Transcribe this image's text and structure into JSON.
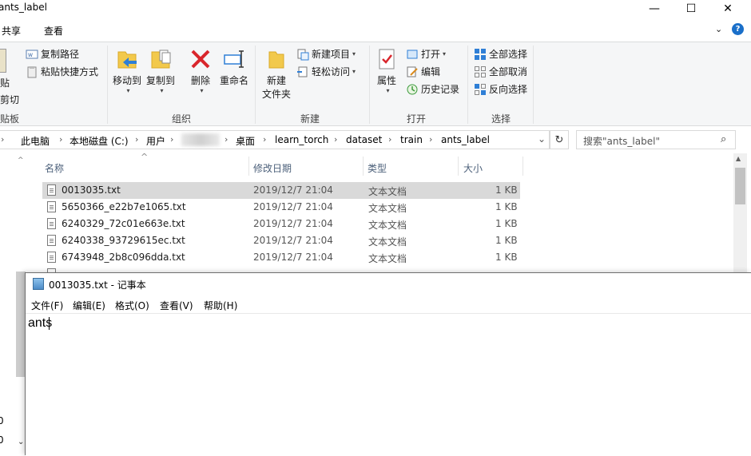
{
  "window": {
    "title": "ants_label",
    "min_glyph": "—",
    "max_glyph": "☐",
    "close_glyph": "✕"
  },
  "ribbon_tabs": [
    {
      "label": "共享"
    },
    {
      "label": "查看"
    }
  ],
  "ribbon": {
    "clipboard": {
      "paste_partial": "贴",
      "cut_partial": "剪切",
      "group_partial": "贴板",
      "copy_path": "复制路径",
      "paste_shortcut": "粘贴快捷方式"
    },
    "organize": {
      "move_to": "移动到",
      "copy_to": "复制到",
      "delete": "删除",
      "rename": "重命名",
      "group": "组织"
    },
    "new": {
      "new_folder_line1": "新建",
      "new_folder_line2": "文件夹",
      "new_item": "新建项目",
      "easy_access": "轻松访问",
      "group": "新建"
    },
    "open": {
      "properties": "属性",
      "open": "打开",
      "edit": "编辑",
      "history": "历史记录",
      "group": "打开"
    },
    "select": {
      "select_all": "全部选择",
      "select_none": "全部取消",
      "invert": "反向选择",
      "group": "选择"
    }
  },
  "address": {
    "crumbs": [
      "此电脑",
      "本地磁盘 (C:)",
      "用户",
      "桌面",
      "learn_torch",
      "dataset",
      "train",
      "ants_label"
    ],
    "search_placeholder": "搜索\"ants_label\""
  },
  "columns": {
    "name": "名称",
    "date": "修改日期",
    "type": "类型",
    "size": "大小"
  },
  "files": [
    {
      "name": "0013035.txt",
      "date": "2019/12/7 21:04",
      "type": "文本文档",
      "size": "1 KB"
    },
    {
      "name": "5650366_e22b7e1065.txt",
      "date": "2019/12/7 21:04",
      "type": "文本文档",
      "size": "1 KB"
    },
    {
      "name": "6240329_72c01e663e.txt",
      "date": "2019/12/7 21:04",
      "type": "文本文档",
      "size": "1 KB"
    },
    {
      "name": "6240338_93729615ec.txt",
      "date": "2019/12/7 21:04",
      "type": "文本文档",
      "size": "1 KB"
    },
    {
      "name": "6743948_2b8c096dda.txt",
      "date": "2019/12/7 21:04",
      "type": "文本文档",
      "size": "1 KB"
    }
  ],
  "left_digits": [
    "0",
    "0"
  ],
  "notepad": {
    "title": "0013035.txt - 记事本",
    "menus": [
      "文件(F)",
      "编辑(E)",
      "格式(O)",
      "查看(V)",
      "帮助(H)"
    ],
    "content": "ants"
  },
  "colors": {
    "accent": "#1a6fc9",
    "selection": "#d9d9d9",
    "ribbon_bg": "#f5f6f7"
  }
}
